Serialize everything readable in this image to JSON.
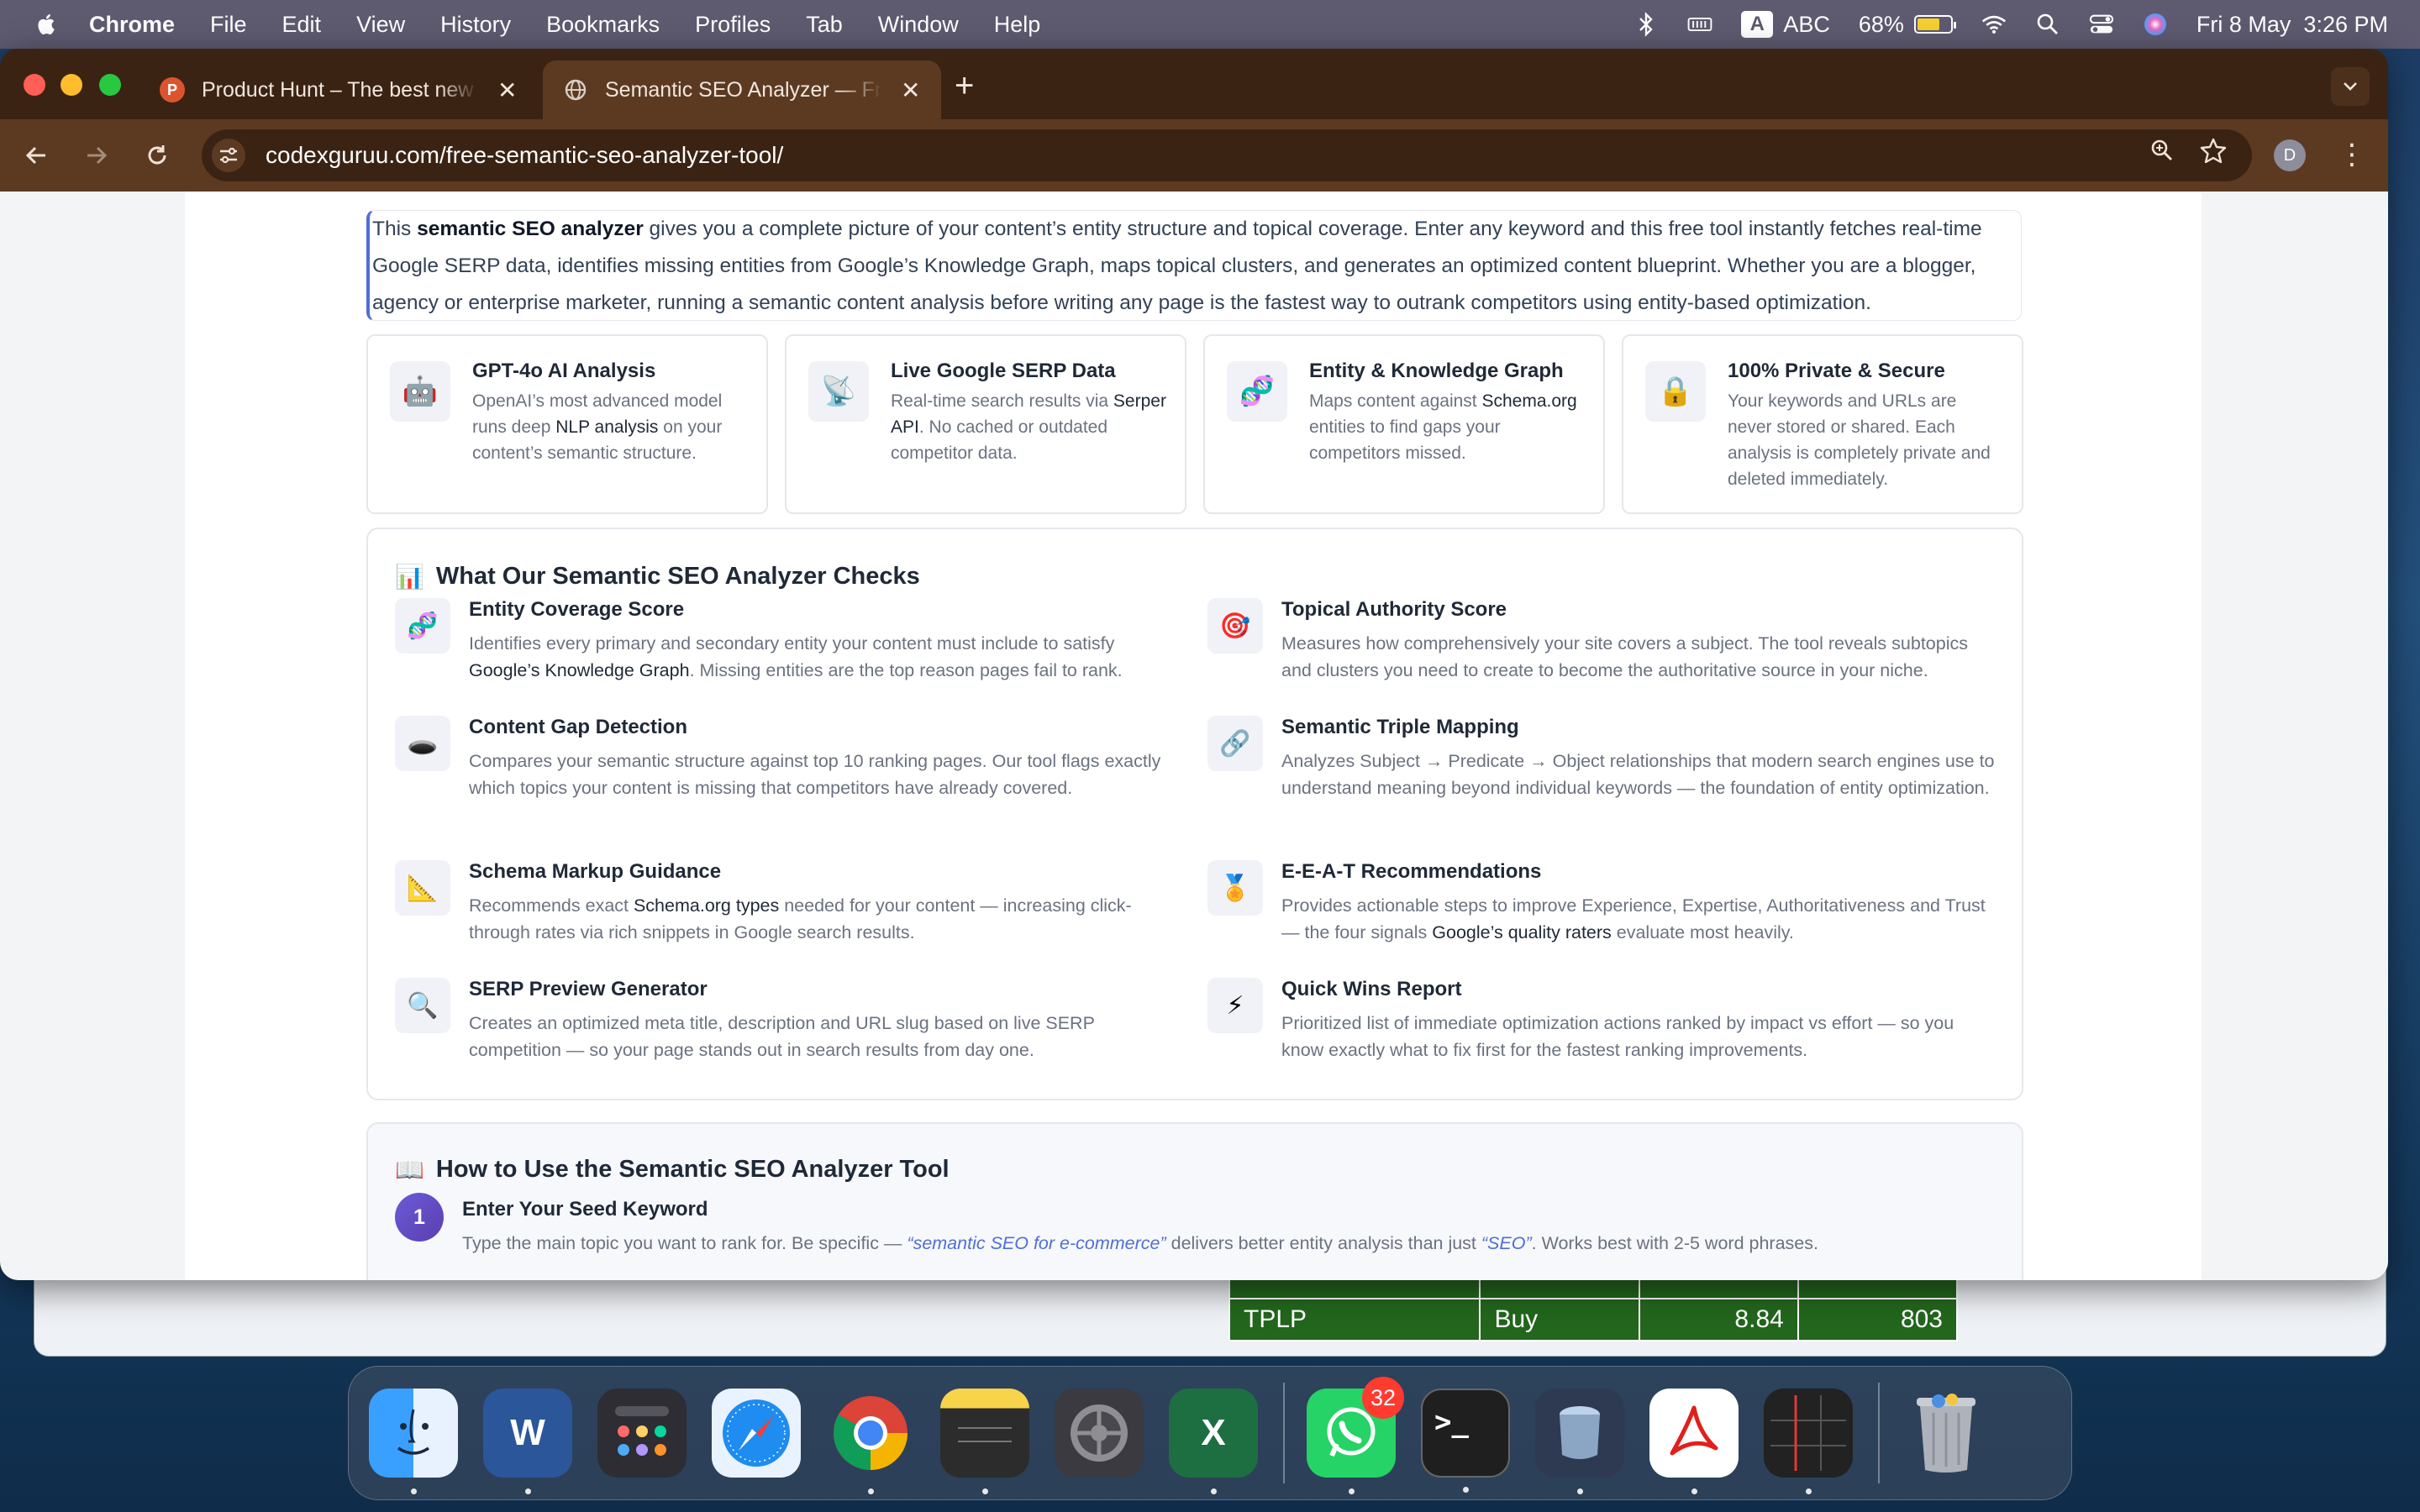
{
  "menubar": {
    "app_name": "Chrome",
    "menus": [
      "File",
      "Edit",
      "View",
      "History",
      "Bookmarks",
      "Profiles",
      "Tab",
      "Window",
      "Help"
    ],
    "input_source": "A",
    "input_label": "ABC",
    "battery_percent": "68%",
    "battery_level": 0.68,
    "datetime": "Fri 8 May  3:26 PM"
  },
  "tabs": [
    {
      "title": "Product Hunt – The best new products in tech",
      "favicon_letter": "P",
      "favicon_color": "#da552f",
      "active": false
    },
    {
      "title": "Semantic SEO Analyzer — Free Semantic SEO",
      "favicon_letter": "",
      "favicon_color": "#8a7a70",
      "active": true
    }
  ],
  "toolbar": {
    "url": "codexguruu.com/free-semantic-seo-analyzer-tool/",
    "profile_initial": "D"
  },
  "page": {
    "intro": {
      "text_before": "This ",
      "bold": "semantic SEO analyzer",
      "text_after": " gives you a complete picture of your content’s entity structure and topical coverage. Enter any keyword and this free tool instantly fetches real-time Google SERP data, identifies missing entities from Google’s Knowledge Graph, maps topical clusters, and generates an optimized content blueprint. Whether you are a blogger, agency or enterprise marketer, running a semantic content analysis before writing any page is the fastest way to outrank competitors using entity-based optimization."
    },
    "features": [
      {
        "icon": "🤖",
        "icon_name": "robot-icon",
        "title": "GPT-4o AI Analysis",
        "d1": "OpenAI’s most advanced model runs deep ",
        "hl": "NLP analysis",
        "d2": " on your content’s semantic structure."
      },
      {
        "icon": "📡",
        "icon_name": "satellite-icon",
        "title": "Live Google SERP Data",
        "d1": "Real-time search results via ",
        "hl": "Serper API",
        "d2": ". No cached or outdated competitor data."
      },
      {
        "icon": "🧬",
        "icon_name": "dna-icon",
        "title": "Entity & Knowledge Graph",
        "d1": "Maps content against ",
        "hl": "Schema.org",
        "d2": " entities to find gaps your competitors missed."
      },
      {
        "icon": "🔒",
        "icon_name": "lock-icon",
        "title": "100% Private & Secure",
        "d1": "Your keywords and URLs are never stored or shared. Each analysis is completely private and deleted immediately.",
        "hl": "",
        "d2": ""
      }
    ],
    "checks_section": {
      "icon": "📊",
      "title": "What Our Semantic SEO Analyzer Checks",
      "items": [
        {
          "icon": "🧬",
          "icon_name": "dna-icon",
          "title": "Entity Coverage Score",
          "d1": "Identifies every primary and secondary entity your content must include to satisfy ",
          "hl": "Google’s Knowledge Graph",
          "d2": ". Missing entities are the top reason pages fail to rank."
        },
        {
          "icon": "🎯",
          "icon_name": "target-icon",
          "title": "Topical Authority Score",
          "d1": "Measures how comprehensively your site covers a subject. The tool reveals subtopics and clusters you need to create to become the authoritative source in your niche.",
          "hl": "",
          "d2": ""
        },
        {
          "icon": "🕳️",
          "icon_name": "hole-icon",
          "title": "Content Gap Detection",
          "d1": "Compares your semantic structure against top 10 ranking pages. Our tool flags exactly which topics your content is missing that competitors have already covered.",
          "hl": "",
          "d2": ""
        },
        {
          "icon": "🔗",
          "icon_name": "link-icon",
          "title": "Semantic Triple Mapping",
          "d1": "Analyzes Subject → Predicate → Object relationships that modern search engines use to understand meaning beyond individual keywords — the foundation of entity optimization.",
          "hl": "",
          "d2": ""
        },
        {
          "icon": "📐",
          "icon_name": "ruler-icon",
          "title": "Schema Markup Guidance",
          "d1": "Recommends exact ",
          "hl": "Schema.org types",
          "d2": " needed for your content — increasing click-through rates via rich snippets in Google search results."
        },
        {
          "icon": "🏅",
          "icon_name": "medal-icon",
          "title": "E-E-A-T Recommendations",
          "d1": "Provides actionable steps to improve Experience, Expertise, Authoritativeness and Trust — the four signals ",
          "hl": "Google’s quality raters",
          "d2": " evaluate most heavily."
        },
        {
          "icon": "🔍",
          "icon_name": "magnifier-icon",
          "title": "SERP Preview Generator",
          "d1": "Creates an optimized meta title, description and URL slug based on live SERP competition — so your page stands out in search results from day one.",
          "hl": "",
          "d2": ""
        },
        {
          "icon": "⚡",
          "icon_name": "lightning-icon",
          "title": "Quick Wins Report",
          "d1": "Prioritized list of immediate optimization actions ranked by impact vs effort — so you know exactly what to fix first for the fastest ranking improvements.",
          "hl": "",
          "d2": ""
        }
      ]
    },
    "howto": {
      "icon": "📖",
      "title": "How to Use the Semantic SEO Analyzer Tool",
      "step_number": "1",
      "step_title": "Enter Your Seed Keyword",
      "step_d1": "Type the main topic you want to rank for. Be specific — ",
      "step_i1": "“semantic SEO for e-commerce”",
      "step_d2": " delivers better entity analysis than just ",
      "step_i2": "“SEO”",
      "step_d3": ". Works best with 2-5 word phrases."
    }
  },
  "background_sheet": {
    "rows": [
      [
        "TPLP",
        "Buy",
        "8.84",
        "803"
      ]
    ]
  },
  "dock": {
    "whatsapp_badge": "32"
  }
}
